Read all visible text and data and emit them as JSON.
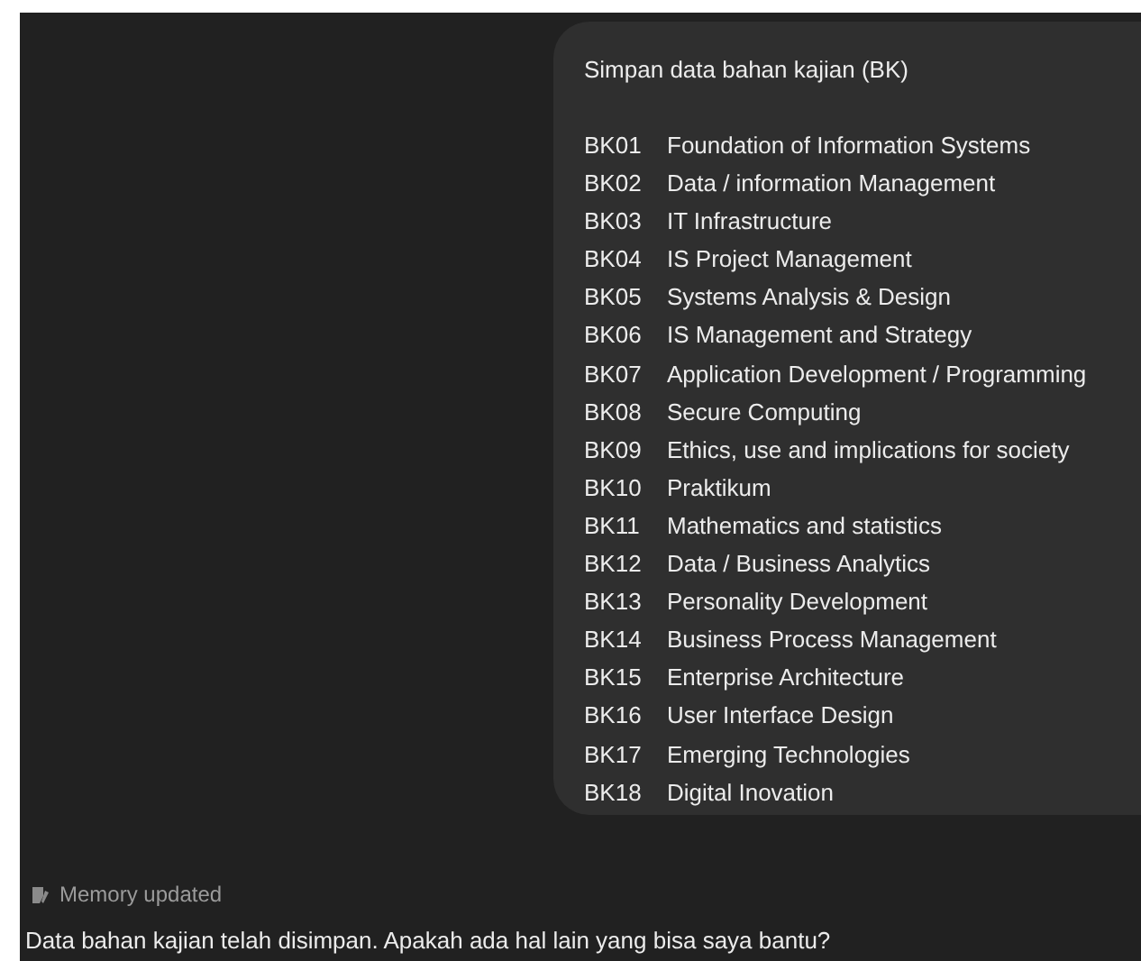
{
  "user_message": {
    "title": "Simpan data bahan kajian (BK)",
    "items": [
      {
        "code": "BK01",
        "name": "Foundation of Information Systems"
      },
      {
        "code": "BK02",
        "name": "Data / information Management"
      },
      {
        "code": "BK03",
        "name": "IT Infrastructure"
      },
      {
        "code": "BK04",
        "name": "IS Project Management"
      },
      {
        "code": "BK05",
        "name": "Systems Analysis & Design"
      },
      {
        "code": "BK06",
        "name": "IS Management and Strategy"
      },
      {
        "code": "BK07",
        "name": "Application Development / Programming"
      },
      {
        "code": "BK08",
        "name": "Secure Computing"
      },
      {
        "code": "BK09",
        "name": "Ethics, use and implications for society"
      },
      {
        "code": "BK10",
        "name": "Praktikum"
      },
      {
        "code": "BK11",
        "name": "Mathematics and statistics"
      },
      {
        "code": "BK12",
        "name": "Data / Business Analytics"
      },
      {
        "code": "BK13",
        "name": "Personality Development"
      },
      {
        "code": "BK14",
        "name": "Business Process Management"
      },
      {
        "code": "BK15",
        "name": "Enterprise Architecture"
      },
      {
        "code": "BK16",
        "name": "User Interface Design"
      },
      {
        "code": "BK17",
        "name": "Emerging Technologies"
      },
      {
        "code": "BK18",
        "name": "Digital Inovation"
      }
    ]
  },
  "memory_status": "Memory updated",
  "assistant_message": "Data bahan kajian telah disimpan. Apakah ada hal lain yang bisa saya bantu?"
}
